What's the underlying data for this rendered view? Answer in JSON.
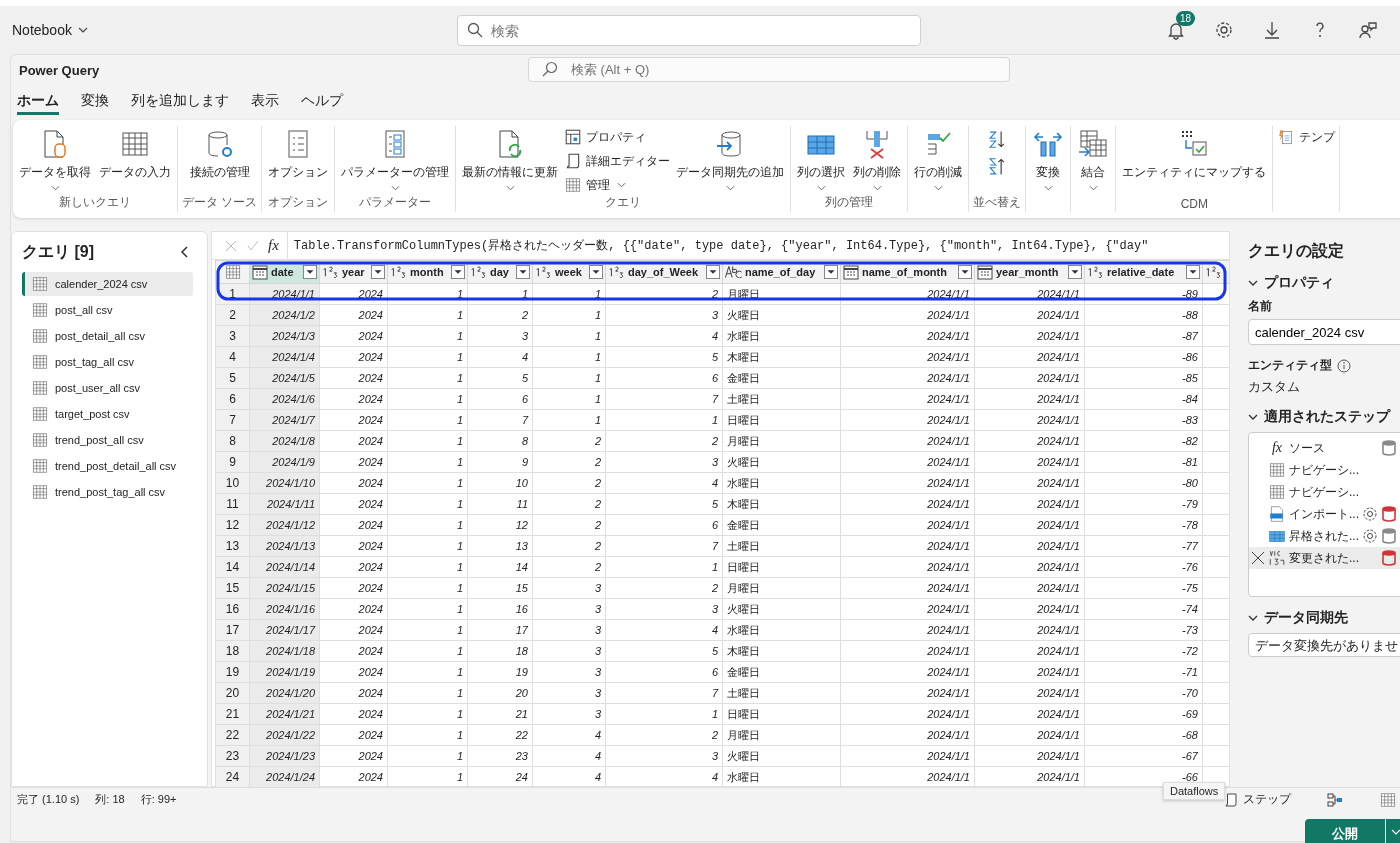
{
  "app": {
    "title": "Notebook",
    "search_placeholder": "検索",
    "notification_count": "18"
  },
  "power_query": {
    "title": "Power Query",
    "search_placeholder": "検索 (Alt + Q)",
    "tabs": [
      {
        "label": "ホーム",
        "selected": true
      },
      {
        "label": "変換",
        "selected": false
      },
      {
        "label": "列を追加します",
        "selected": false
      },
      {
        "label": "表示",
        "selected": false
      },
      {
        "label": "ヘルプ",
        "selected": false
      }
    ],
    "ribbon": [
      {
        "label": "新しいクエリ",
        "items": [
          {
            "kind": "large",
            "label": "データを取得",
            "dropdown": true
          },
          {
            "kind": "large",
            "label": "データの入力",
            "dropdown": false
          }
        ]
      },
      {
        "label": "データ ソース",
        "items": [
          {
            "kind": "large",
            "label": "接続の管理",
            "dropdown": false
          }
        ]
      },
      {
        "label": "オプション",
        "items": [
          {
            "kind": "large",
            "label": "オプション",
            "dropdown": false
          }
        ]
      },
      {
        "label": "パラメーター",
        "items": [
          {
            "kind": "large",
            "label": "パラメーターの管理",
            "dropdown": true
          }
        ]
      },
      {
        "label": "クエリ",
        "items": [
          {
            "kind": "large",
            "label": "最新の情報に更新",
            "dropdown": true
          },
          {
            "kind": "stack",
            "items": [
              {
                "label": "プロパティ",
                "dropdown": false
              },
              {
                "label": "詳細エディター",
                "dropdown": false
              },
              {
                "label": "管理",
                "dropdown": true
              }
            ]
          },
          {
            "kind": "large",
            "label": "データ同期先の追加",
            "dropdown": true
          }
        ]
      },
      {
        "label": "列の管理",
        "items": [
          {
            "kind": "large",
            "label": "列の選択",
            "dropdown": true
          },
          {
            "kind": "large",
            "label": "列の削除",
            "dropdown": true
          }
        ]
      },
      {
        "items": [
          {
            "kind": "large",
            "label": "行の削減",
            "dropdown": true
          }
        ]
      },
      {
        "label": "並べ替え",
        "items": [
          {
            "kind": "icons"
          }
        ]
      },
      {
        "items": [
          {
            "kind": "large",
            "label": "変換",
            "dropdown": true
          }
        ]
      },
      {
        "items": [
          {
            "kind": "large",
            "label": "結合",
            "dropdown": true
          }
        ]
      },
      {
        "label": "CDM",
        "items": [
          {
            "kind": "large",
            "label": "エンティティにマップする",
            "dropdown": false
          }
        ]
      },
      {
        "items": [
          {
            "kind": "small",
            "label": "テンプ"
          }
        ]
      }
    ],
    "queries": {
      "title": "クエリ [9]",
      "items": [
        {
          "label": "calender_2024 csv",
          "selected": true
        },
        {
          "label": "post_all csv",
          "selected": false
        },
        {
          "label": "post_detail_all csv",
          "selected": false
        },
        {
          "label": "post_tag_all csv",
          "selected": false
        },
        {
          "label": "post_user_all csv",
          "selected": false
        },
        {
          "label": "target_post csv",
          "selected": false
        },
        {
          "label": "trend_post_all csv",
          "selected": false
        },
        {
          "label": "trend_post_detail_all csv",
          "selected": false
        },
        {
          "label": "trend_post_tag_all csv",
          "selected": false
        }
      ]
    },
    "formula_icon": "fx",
    "formula": "Table.TransformColumnTypes(昇格されたヘッダー数, {{\"date\", type date}, {\"year\", Int64.Type}, {\"month\", Int64.Type}, {\"day\"",
    "grid": {
      "columns": [
        {
          "label": "date",
          "kind": "date",
          "selected": true
        },
        {
          "label": "year",
          "kind": "number",
          "selected": false
        },
        {
          "label": "month",
          "kind": "number",
          "selected": false
        },
        {
          "label": "day",
          "kind": "number",
          "selected": false
        },
        {
          "label": "week",
          "kind": "number",
          "selected": false
        },
        {
          "label": "day_of_Week",
          "kind": "number",
          "selected": false
        },
        {
          "label": "name_of_day",
          "kind": "text",
          "selected": false
        },
        {
          "label": "name_of_month",
          "kind": "date",
          "selected": false
        },
        {
          "label": "year_month",
          "kind": "date",
          "selected": false
        },
        {
          "label": "relative_date",
          "kind": "number",
          "selected": false
        },
        {
          "kind": "number",
          "selected": false
        }
      ],
      "rows": [
        {
          "row": "1",
          "cells": [
            "2024/1/1",
            "2024",
            "1",
            "1",
            "1",
            "2",
            "月曜日",
            "2024/1/1",
            "2024/1/1",
            "-89"
          ]
        },
        {
          "row": "2",
          "cells": [
            "2024/1/2",
            "2024",
            "1",
            "2",
            "1",
            "3",
            "火曜日",
            "2024/1/1",
            "2024/1/1",
            "-88"
          ]
        },
        {
          "row": "3",
          "cells": [
            "2024/1/3",
            "2024",
            "1",
            "3",
            "1",
            "4",
            "水曜日",
            "2024/1/1",
            "2024/1/1",
            "-87"
          ]
        },
        {
          "row": "4",
          "cells": [
            "2024/1/4",
            "2024",
            "1",
            "4",
            "1",
            "5",
            "木曜日",
            "2024/1/1",
            "2024/1/1",
            "-86"
          ]
        },
        {
          "row": "5",
          "cells": [
            "2024/1/5",
            "2024",
            "1",
            "5",
            "1",
            "6",
            "金曜日",
            "2024/1/1",
            "2024/1/1",
            "-85"
          ]
        },
        {
          "row": "6",
          "cells": [
            "2024/1/6",
            "2024",
            "1",
            "6",
            "1",
            "7",
            "土曜日",
            "2024/1/1",
            "2024/1/1",
            "-84"
          ]
        },
        {
          "row": "7",
          "cells": [
            "2024/1/7",
            "2024",
            "1",
            "7",
            "1",
            "1",
            "日曜日",
            "2024/1/1",
            "2024/1/1",
            "-83"
          ]
        },
        {
          "row": "8",
          "cells": [
            "2024/1/8",
            "2024",
            "1",
            "8",
            "2",
            "2",
            "月曜日",
            "2024/1/1",
            "2024/1/1",
            "-82"
          ]
        },
        {
          "row": "9",
          "cells": [
            "2024/1/9",
            "2024",
            "1",
            "9",
            "2",
            "3",
            "火曜日",
            "2024/1/1",
            "2024/1/1",
            "-81"
          ]
        },
        {
          "row": "10",
          "cells": [
            "2024/1/10",
            "2024",
            "1",
            "10",
            "2",
            "4",
            "水曜日",
            "2024/1/1",
            "2024/1/1",
            "-80"
          ]
        },
        {
          "row": "11",
          "cells": [
            "2024/1/11",
            "2024",
            "1",
            "11",
            "2",
            "5",
            "木曜日",
            "2024/1/1",
            "2024/1/1",
            "-79"
          ]
        },
        {
          "row": "12",
          "cells": [
            "2024/1/12",
            "2024",
            "1",
            "12",
            "2",
            "6",
            "金曜日",
            "2024/1/1",
            "2024/1/1",
            "-78"
          ]
        },
        {
          "row": "13",
          "cells": [
            "2024/1/13",
            "2024",
            "1",
            "13",
            "2",
            "7",
            "土曜日",
            "2024/1/1",
            "2024/1/1",
            "-77"
          ]
        },
        {
          "row": "14",
          "cells": [
            "2024/1/14",
            "2024",
            "1",
            "14",
            "2",
            "1",
            "日曜日",
            "2024/1/1",
            "2024/1/1",
            "-76"
          ]
        },
        {
          "row": "15",
          "cells": [
            "2024/1/15",
            "2024",
            "1",
            "15",
            "3",
            "2",
            "月曜日",
            "2024/1/1",
            "2024/1/1",
            "-75"
          ]
        },
        {
          "row": "16",
          "cells": [
            "2024/1/16",
            "2024",
            "1",
            "16",
            "3",
            "3",
            "火曜日",
            "2024/1/1",
            "2024/1/1",
            "-74"
          ]
        },
        {
          "row": "17",
          "cells": [
            "2024/1/17",
            "2024",
            "1",
            "17",
            "3",
            "4",
            "水曜日",
            "2024/1/1",
            "2024/1/1",
            "-73"
          ]
        },
        {
          "row": "18",
          "cells": [
            "2024/1/18",
            "2024",
            "1",
            "18",
            "3",
            "5",
            "木曜日",
            "2024/1/1",
            "2024/1/1",
            "-72"
          ]
        },
        {
          "row": "19",
          "cells": [
            "2024/1/19",
            "2024",
            "1",
            "19",
            "3",
            "6",
            "金曜日",
            "2024/1/1",
            "2024/1/1",
            "-71"
          ]
        },
        {
          "row": "20",
          "cells": [
            "2024/1/20",
            "2024",
            "1",
            "20",
            "3",
            "7",
            "土曜日",
            "2024/1/1",
            "2024/1/1",
            "-70"
          ]
        },
        {
          "row": "21",
          "cells": [
            "2024/1/21",
            "2024",
            "1",
            "21",
            "3",
            "1",
            "日曜日",
            "2024/1/1",
            "2024/1/1",
            "-69"
          ]
        },
        {
          "row": "22",
          "cells": [
            "2024/1/22",
            "2024",
            "1",
            "22",
            "4",
            "2",
            "月曜日",
            "2024/1/1",
            "2024/1/1",
            "-68"
          ]
        },
        {
          "row": "23",
          "cells": [
            "2024/1/23",
            "2024",
            "1",
            "23",
            "4",
            "3",
            "火曜日",
            "2024/1/1",
            "2024/1/1",
            "-67"
          ]
        },
        {
          "row": "24",
          "cells": [
            "2024/1/24",
            "2024",
            "1",
            "24",
            "4",
            "4",
            "水曜日",
            "2024/1/1",
            "2024/1/1",
            "-66"
          ]
        }
      ]
    },
    "settings": {
      "title": "クエリの設定",
      "properties_heading": "プロパティ",
      "name_label": "名前",
      "name_value": "calender_2024 csv",
      "entity_label": "エンティティ型",
      "entity_value": "カスタム",
      "steps_heading": "適用されたステップ",
      "steps": [
        {
          "label": "ソース",
          "icon_text": "fx",
          "settings": false,
          "selected": false,
          "color": "#8a8a8a"
        },
        {
          "label": "ナビゲーシ...",
          "settings": false,
          "selected": false
        },
        {
          "label": "ナビゲーシ...",
          "settings": false,
          "selected": false
        },
        {
          "label": "インポート...",
          "settings": true,
          "selected": false,
          "color": "#d13438"
        },
        {
          "label": "昇格された...",
          "settings": true,
          "selected": false,
          "color": "#8a8a8a"
        },
        {
          "label": "変更された...",
          "settings": false,
          "selected": true,
          "color": "#d13438"
        }
      ],
      "destination_heading": "データ同期先",
      "destination_value": "データ変換先がありませ"
    },
    "status": {
      "items": [
        "完了 (1.10 s)",
        "列: 18",
        "行: 99+"
      ],
      "tooltip": "Dataflows",
      "steps_button": "ステップ"
    },
    "publish_button": "公開"
  }
}
